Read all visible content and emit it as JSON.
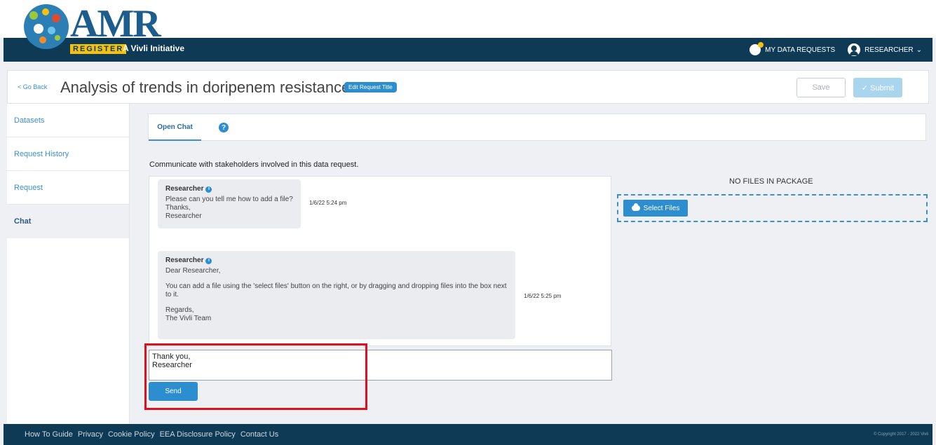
{
  "brand": {
    "logo_text": "AMR",
    "register_label": "REGISTER",
    "initiative": "A Vivli Initiative"
  },
  "topnav": {
    "data_requests": "MY DATA REQUESTS",
    "user": "RESEARCHER",
    "caret": "⌄"
  },
  "titlebar": {
    "go_back": "< Go Back",
    "title": "Analysis of trends in doripenem resistance",
    "edit_title": "Edit Request Title",
    "save": "Save",
    "submit": "✓  Submit"
  },
  "sidebar": {
    "items": [
      {
        "label": "Datasets"
      },
      {
        "label": "Request History"
      },
      {
        "label": "Request"
      },
      {
        "label": "Chat"
      }
    ]
  },
  "tabs": {
    "open_chat": "Open Chat",
    "help": "?"
  },
  "chat": {
    "intro": "Communicate with stakeholders involved in this data request.",
    "messages": [
      {
        "author": "Researcher",
        "lines": [
          "Please can you tell me how to add a file?",
          "Thanks,",
          "Researcher"
        ],
        "timestamp": "1/6/22 5:24 pm"
      },
      {
        "author": "Researcher",
        "greeting": "Dear Researcher,",
        "body": "You can add a file using the 'select files' button on the right, or by dragging and dropping files into the box next to it.",
        "sign_1": "Regards,",
        "sign_2": "The Vivli Team",
        "timestamp": "1/6/22 5:25 pm"
      }
    ],
    "reply_value": "Thank you,\nResearcher",
    "send": "Send"
  },
  "files": {
    "empty_label": "NO FILES IN PACKAGE",
    "select_files": "Select Files"
  },
  "footer": {
    "links": [
      "How To Guide",
      "Privacy",
      "Cookie Policy",
      "EEA Disclosure Policy",
      "Contact Us"
    ],
    "copyright": "© Copyright 2017 - 2022 Vivli"
  },
  "colors": {
    "navy": "#0e3a55",
    "accent_blue": "#2d8ecf",
    "register_yellow": "#f4c20d",
    "highlight_red": "#e0101f"
  }
}
